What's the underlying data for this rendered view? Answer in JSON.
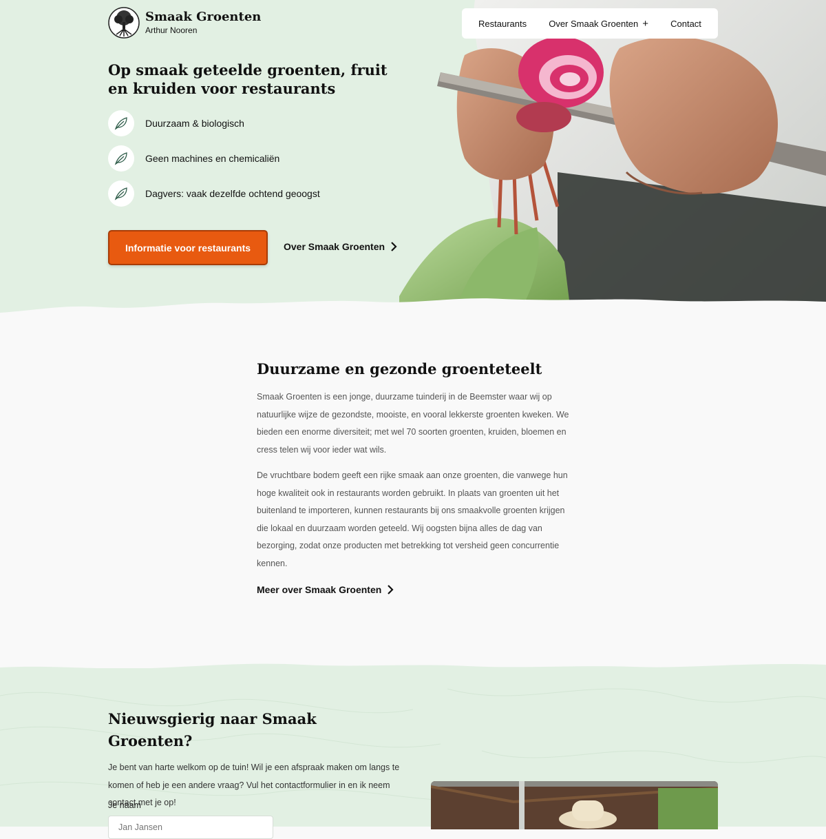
{
  "brand": {
    "name": "Smaak Groenten",
    "owner": "Arthur Nooren"
  },
  "nav": {
    "items": [
      "Restaurants",
      "Over Smaak Groenten",
      "Contact"
    ],
    "dropdown_icon": "+"
  },
  "hero": {
    "title": "Op smaak geteelde groenten, fruit en kruiden voor restaurants",
    "features": [
      "Duurzaam & biologisch",
      "Geen machines en chemicaliën",
      "Dagvers: vaak dezelfde ochtend geoogst"
    ],
    "feature_icon": "leaf-icon",
    "primary_button": "Informatie voor restaurants",
    "secondary_link": "Over Smaak Groenten"
  },
  "about": {
    "title": "Duurzame en gezonde groenteteelt",
    "paragraph1": "Smaak Groenten is een jonge, duurzame tuinderij in de Beemster waar wij op natuurlijke wijze de gezondste, mooiste, en vooral lekkerste groenten kweken. We bieden een enorme diversiteit; met wel 70 soorten groenten, kruiden, bloemen en cress telen wij voor ieder wat wils.",
    "paragraph2": "De vruchtbare bodem geeft een rijke smaak aan onze groenten, die vanwege hun hoge kwaliteit ook in restaurants worden gebruikt. In plaats van groenten uit het buitenland te importeren, kunnen restaurants bij ons smaakvolle groenten krijgen die lokaal en duurzaam worden geteeld. Wij oogsten bijna alles de dag van bezorging, zodat onze producten met betrekking tot versheid geen concurrentie kennen.",
    "link": "Meer over Smaak Groenten"
  },
  "contact": {
    "title": "Nieuwsgierig naar Smaak Groenten?",
    "text": "Je bent van harte welkom op de tuin! Wil je een afspraak maken om langs te komen of heb je een andere vraag? Vul het contactformulier in en ik neem contact met je op!",
    "name_label": "Je naam",
    "name_placeholder": "Jan Jansen"
  },
  "colors": {
    "mint": "#e2f0e3",
    "accent": "#e85a10",
    "background": "#f9f9f9"
  }
}
